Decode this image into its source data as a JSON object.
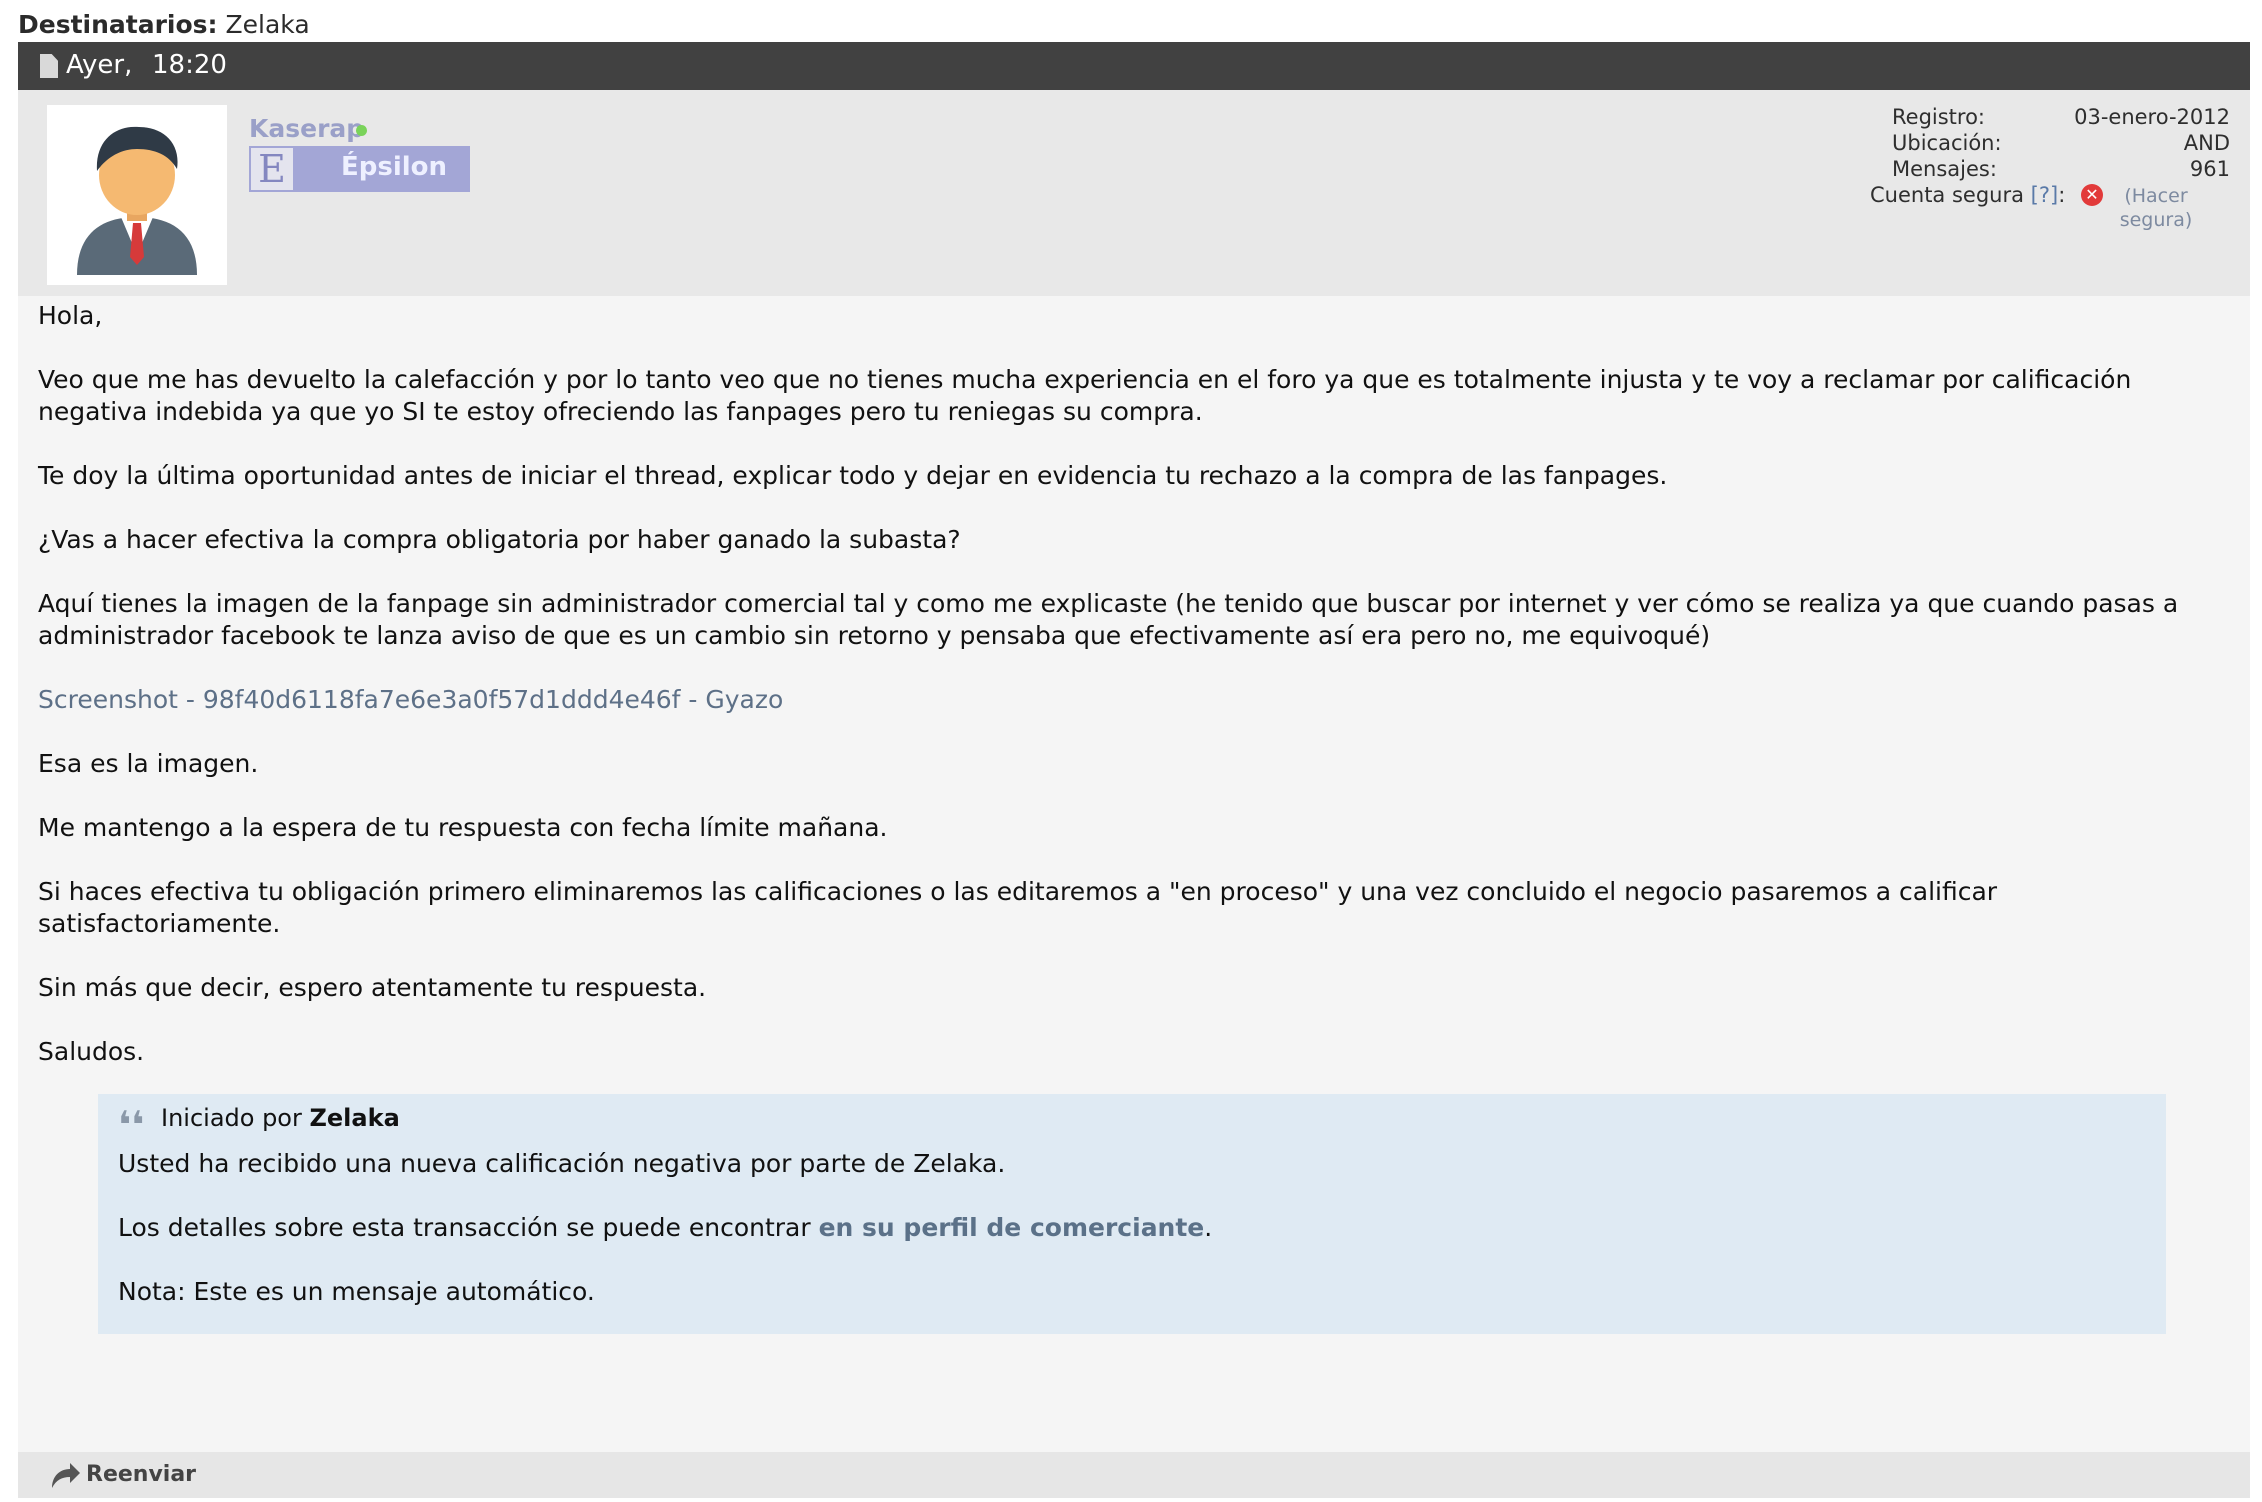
{
  "recipients": {
    "label": "Destinatarios:",
    "value": "Zelaka"
  },
  "post": {
    "day": "Ayer,",
    "time": "18:20"
  },
  "user": {
    "name": "Kaserap",
    "rank_letter": "E",
    "rank_name": "Épsilon",
    "stats": {
      "registro_label": "Registro:",
      "registro_value": "03-enero-2012",
      "ubicacion_label": "Ubicación:",
      "ubicacion_value": "AND",
      "mensajes_label": "Mensajes:",
      "mensajes_value": "961",
      "cuenta_label": "Cuenta segura",
      "cuenta_help": "[?]",
      "cuenta_colon": ":",
      "cuenta_status_icon": "error-x-icon",
      "make_secure": "(Hacer segura)"
    }
  },
  "message": {
    "p1": "Hola,",
    "p2": "Veo que me has devuelto la calefacción y por lo tanto veo que no tienes mucha experiencia en el foro ya que es totalmente injusta y te voy a reclamar por calificación negativa indebida ya que yo SI te estoy ofreciendo las fanpages pero tu reniegas su compra.",
    "p3": "Te doy la última oportunidad antes de iniciar el thread, explicar todo y dejar en evidencia tu rechazo a la compra de las fanpages.",
    "p4": "¿Vas a hacer efectiva la compra obligatoria por haber ganado la subasta?",
    "p5": "Aquí tienes la imagen de la fanpage sin administrador comercial tal y como me explicaste (he tenido que buscar por internet y ver cómo se realiza ya que cuando pasas a administrador facebook te lanza aviso de que es un cambio sin retorno y pensaba que efectivamente así era pero no, me equivoqué)",
    "link": "Screenshot - 98f40d6118fa7e6e3a0f57d1ddd4e46f - Gyazo",
    "p6": "Esa es la imagen.",
    "p7": "Me mantengo a la espera de tu respuesta con fecha límite mañana.",
    "p8": "Si haces efectiva tu obligación primero eliminaremos las calificaciones o las editaremos a \"en proceso\" y una vez concluido el negocio pasaremos a calificar satisfactoriamente.",
    "p9": "Sin más que decir, espero atentamente tu respuesta.",
    "p10": "Saludos."
  },
  "quote": {
    "icon": "quote-icon",
    "started_by": "Iniciado por",
    "author": "Zelaka",
    "line1": "Usted ha recibido una nueva calificación negativa por parte de Zelaka.",
    "line2_prefix": "Los detalles sobre esta transacción se puede encontrar",
    "line2_link": "en su perfil de comerciante",
    "line2_suffix": ".",
    "line3": "Nota: Este es un mensaje automático."
  },
  "footer": {
    "forward_label": "Reenviar",
    "forward_icon": "forward-arrow-icon"
  }
}
